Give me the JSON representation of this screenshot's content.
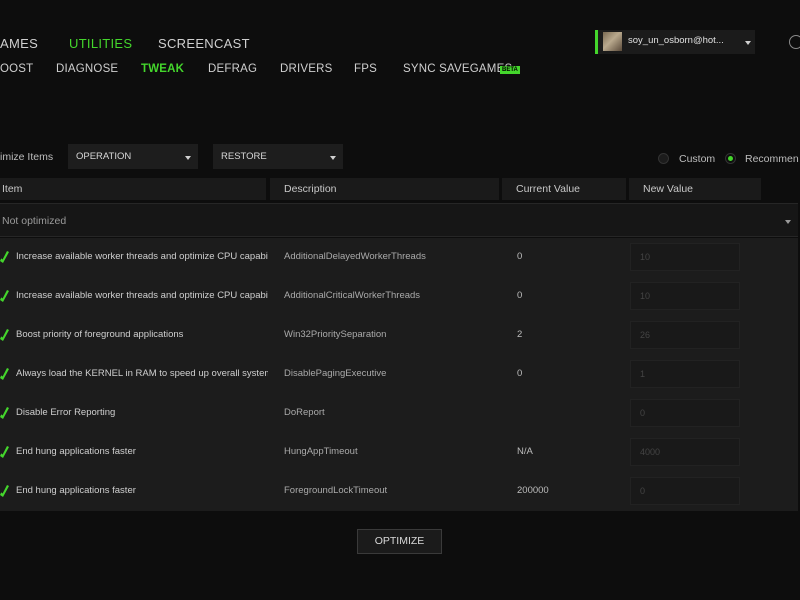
{
  "topnav": {
    "games": "AMES",
    "utilities": "UTILITIES",
    "screencast": "SCREENCAST"
  },
  "subnav": {
    "boost": "OOST",
    "diagnose": "DIAGNOSE",
    "tweak": "TWEAK",
    "defrag": "DEFRAG",
    "drivers": "DRIVERS",
    "fps": "FPS",
    "sync": "SYNC SAVEGAMES",
    "beta": "BETA"
  },
  "account": {
    "name": "soy_un_osborn@hot..."
  },
  "filters": {
    "label": "imize Items",
    "operation": "OPERATION",
    "restore": "RESTORE",
    "custom": "Custom",
    "recommended": "Recommen"
  },
  "table": {
    "headers": {
      "item": "Item",
      "description": "Description",
      "current": "Current Value",
      "new": "New Value"
    },
    "group": "Not optimized",
    "rows": [
      {
        "item": "Increase available worker threads and optimize CPU capabilities",
        "desc": "AdditionalDelayedWorkerThreads",
        "current": "0",
        "new": "10"
      },
      {
        "item": "Increase available worker threads and optimize CPU capabilities",
        "desc": "AdditionalCriticalWorkerThreads",
        "current": "0",
        "new": "10"
      },
      {
        "item": "Boost priority of foreground applications",
        "desc": "Win32PrioritySeparation",
        "current": "2",
        "new": "26"
      },
      {
        "item": "Always load the KERNEL in RAM to speed up overall system performance",
        "desc": "DisablePagingExecutive",
        "current": "0",
        "new": "1"
      },
      {
        "item": "Disable Error Reporting",
        "desc": "DoReport",
        "current": "",
        "new": "0"
      },
      {
        "item": "End hung applications faster",
        "desc": "HungAppTimeout",
        "current": "N/A",
        "new": "4000"
      },
      {
        "item": "End hung applications faster",
        "desc": "ForegroundLockTimeout",
        "current": "200000",
        "new": "0"
      }
    ]
  },
  "optimize_label": "OPTIMIZE",
  "colors": {
    "accent": "#44d62c",
    "background": "#0d0d0d",
    "row": "#1c1c1c"
  }
}
